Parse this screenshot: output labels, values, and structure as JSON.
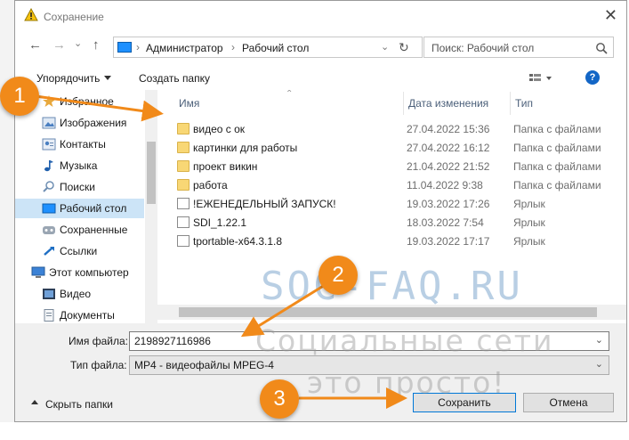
{
  "window": {
    "title": "Сохранение",
    "close_glyph": "✕"
  },
  "nav": {
    "back_glyph": "←",
    "forward_glyph": "→",
    "dropdown_glyph": "⌄",
    "up_glyph": "↑",
    "breadcrumb": [
      "Администратор",
      "Рабочий стол"
    ],
    "separator": "›",
    "refresh_glyph": "↻",
    "search_placeholder": "Поиск: Рабочий стол",
    "search_icon": "search-icon"
  },
  "toolbar": {
    "organize_label": "Упорядочить",
    "new_folder_label": "Создать папку",
    "help_glyph": "?"
  },
  "sidebar": {
    "items": [
      {
        "label": "Избранное",
        "icon": "star-icon",
        "active": false
      },
      {
        "label": "Изображения",
        "icon": "pictures-icon",
        "active": false
      },
      {
        "label": "Контакты",
        "icon": "contacts-icon",
        "active": false
      },
      {
        "label": "Музыка",
        "icon": "music-icon",
        "active": false
      },
      {
        "label": "Поиски",
        "icon": "search-icon",
        "active": false
      },
      {
        "label": "Рабочий стол",
        "icon": "desktop-icon",
        "active": true
      },
      {
        "label": "Сохраненные",
        "icon": "saved-games-icon",
        "active": false
      },
      {
        "label": "Ссылки",
        "icon": "links-icon",
        "active": false
      },
      {
        "label": "Этот компьютер",
        "icon": "computer-icon",
        "active": false
      },
      {
        "label": "Видео",
        "icon": "video-icon",
        "active": false
      },
      {
        "label": "Документы",
        "icon": "documents-icon",
        "active": false
      }
    ]
  },
  "file_list": {
    "columns": [
      "Имя",
      "Дата изменения",
      "Тип"
    ],
    "rows": [
      {
        "name": "видео с ок",
        "date": "27.04.2022 15:36",
        "type": "Папка с файлами",
        "icon": "folder-icon"
      },
      {
        "name": "картинки для работы",
        "date": "27.04.2022 16:12",
        "type": "Папка с файлами",
        "icon": "folder-icon"
      },
      {
        "name": "проект викин",
        "date": "21.04.2022 21:52",
        "type": "Папка с файлами",
        "icon": "folder-icon"
      },
      {
        "name": "работа",
        "date": "11.04.2022 9:38",
        "type": "Папка с файлами",
        "icon": "folder-icon"
      },
      {
        "name": "!ЕЖЕНЕДЕЛЬНЫЙ ЗАПУСК!",
        "date": "19.03.2022 17:26",
        "type": "Ярлык",
        "icon": "shortcut-icon"
      },
      {
        "name": "SDI_1.22.1",
        "date": "18.03.2022 7:54",
        "type": "Ярлык",
        "icon": "shortcut-icon"
      },
      {
        "name": "tportable-x64.3.1.8",
        "date": "19.03.2022 17:17",
        "type": "Ярлык",
        "icon": "shortcut-icon"
      }
    ]
  },
  "form": {
    "filename_label": "Имя файла:",
    "filename_value": "2198927116986",
    "filetype_label": "Тип файла:",
    "filetype_value": "MP4 - видеофайлы MPEG-4",
    "hide_folders_label": "Скрыть папки",
    "save_label": "Сохранить",
    "cancel_label": "Отмена"
  },
  "watermark": {
    "line1": "SOC-FAQ.RU",
    "line2": "Социальные сети",
    "line3": "это просто!"
  },
  "callouts": [
    "1",
    "2",
    "3"
  ],
  "colors": {
    "accent": "#0078d7",
    "callout": "#f18a1a",
    "selected": "#cce4f7",
    "folder": "#f8d775"
  }
}
